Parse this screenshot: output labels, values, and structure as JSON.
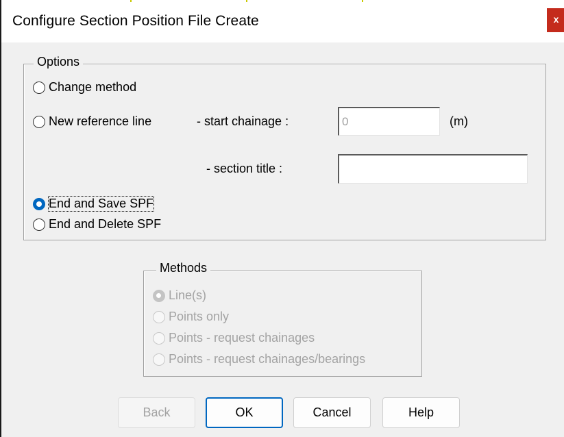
{
  "window": {
    "title": "Configure Section Position File Create",
    "close_glyph": "x"
  },
  "options": {
    "legend": "Options",
    "radios": [
      {
        "label": "Change method",
        "checked": false
      },
      {
        "label": "New reference line",
        "checked": false
      },
      {
        "label": "End and Save SPF",
        "checked": true
      },
      {
        "label": "End and Delete SPF",
        "checked": false
      }
    ],
    "start_chainage": {
      "label": "- start chainage :",
      "value": "0",
      "unit": "(m)"
    },
    "section_title": {
      "label": "- section title :",
      "value": ""
    }
  },
  "methods": {
    "legend": "Methods",
    "radios": [
      {
        "label": "Line(s)",
        "checked": true,
        "enabled": false
      },
      {
        "label": "Points only",
        "checked": false,
        "enabled": false
      },
      {
        "label": "Points - request chainages",
        "checked": false,
        "enabled": false
      },
      {
        "label": "Points - request chainages/bearings",
        "checked": false,
        "enabled": false
      }
    ]
  },
  "buttons": {
    "back": "Back",
    "ok": "OK",
    "cancel": "Cancel",
    "help": "Help"
  },
  "colors": {
    "accent": "#0067c0",
    "close_button": "#c42b1c",
    "dialog_bg": "#f0f0f0",
    "disabled_text": "#a3a3a3"
  }
}
